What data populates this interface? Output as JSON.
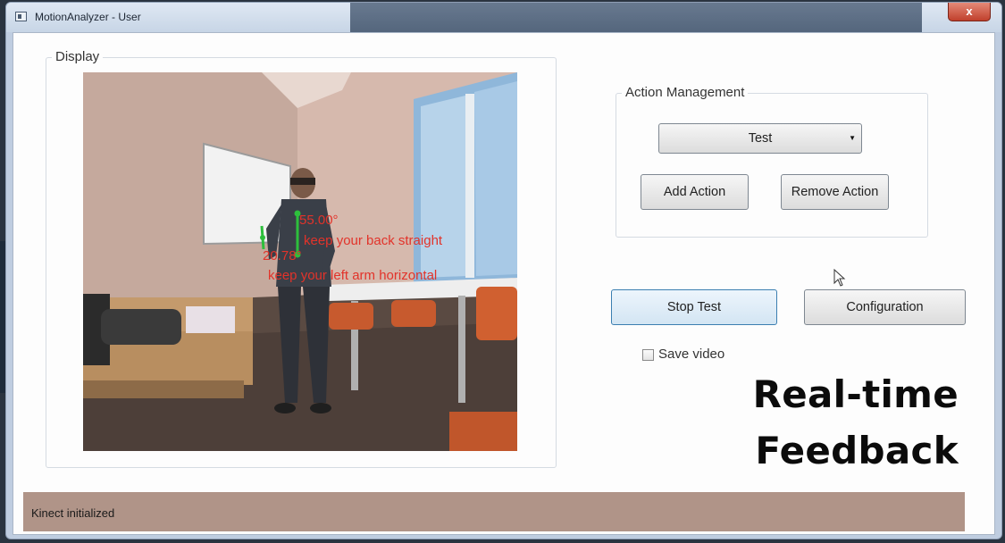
{
  "window": {
    "title": "MotionAnalyzer - User",
    "close_glyph": "x"
  },
  "display": {
    "legend": "Display",
    "overlay": {
      "angle_top": "55.00°",
      "msg_top": "keep your back straight",
      "angle_bottom": "20.78°",
      "msg_bottom": "keep your left arm horizontal"
    }
  },
  "action_management": {
    "legend": "Action Management",
    "selected_action": "Test",
    "add_label": "Add Action",
    "remove_label": "Remove Action"
  },
  "controls": {
    "stop_label": "Stop Test",
    "config_label": "Configuration",
    "save_video_label": "Save video",
    "save_video_checked": false
  },
  "caption": {
    "line1": "Real-time",
    "line2": "Feedback"
  },
  "status": {
    "text": "Kinect initialized"
  },
  "colors": {
    "accent": "#3c7fb1",
    "overlay_text": "#e2332a",
    "skeleton": "#2dbf3c",
    "status_bar": "#b09488"
  }
}
